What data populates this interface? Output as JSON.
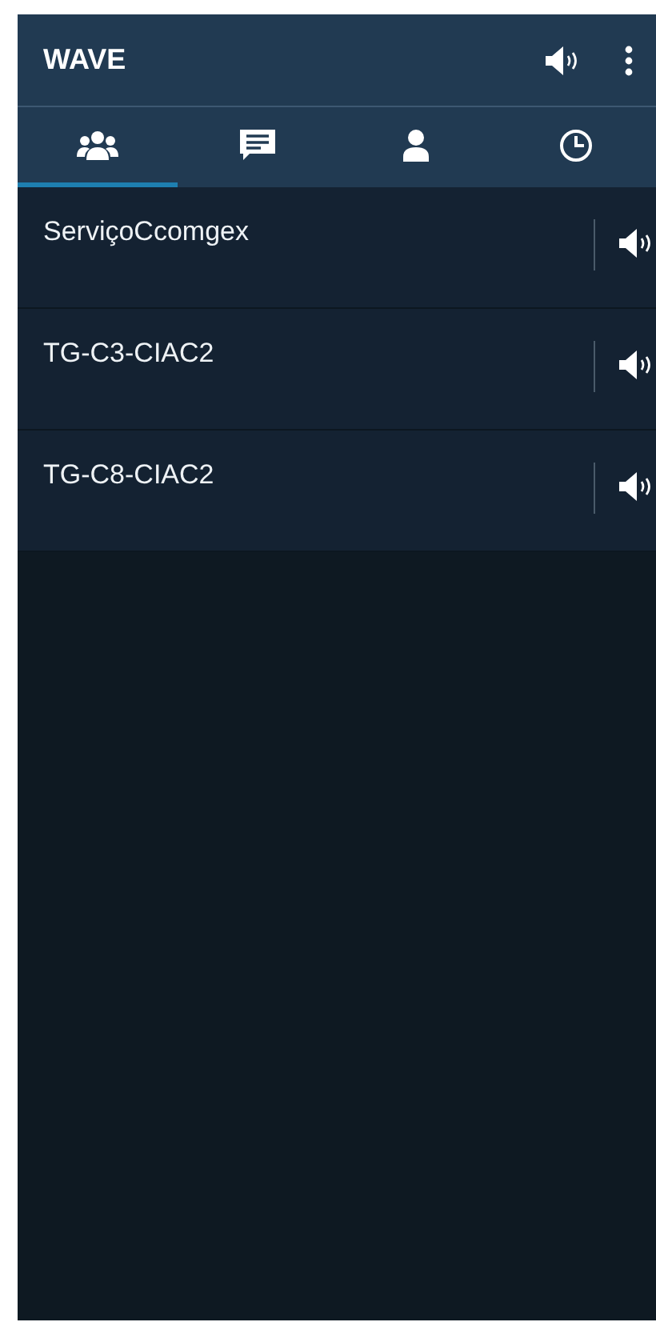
{
  "app_bar": {
    "title": "WAVE"
  },
  "tabs": [
    {
      "kind": "groups",
      "selected": true
    },
    {
      "kind": "messages",
      "selected": false
    },
    {
      "kind": "contacts",
      "selected": false
    },
    {
      "kind": "history",
      "selected": false
    }
  ],
  "channels": [
    {
      "name": "ServiçoCcomgex"
    },
    {
      "name": "TG-C3-CIAC2"
    },
    {
      "name": "TG-C8-CIAC2"
    }
  ]
}
